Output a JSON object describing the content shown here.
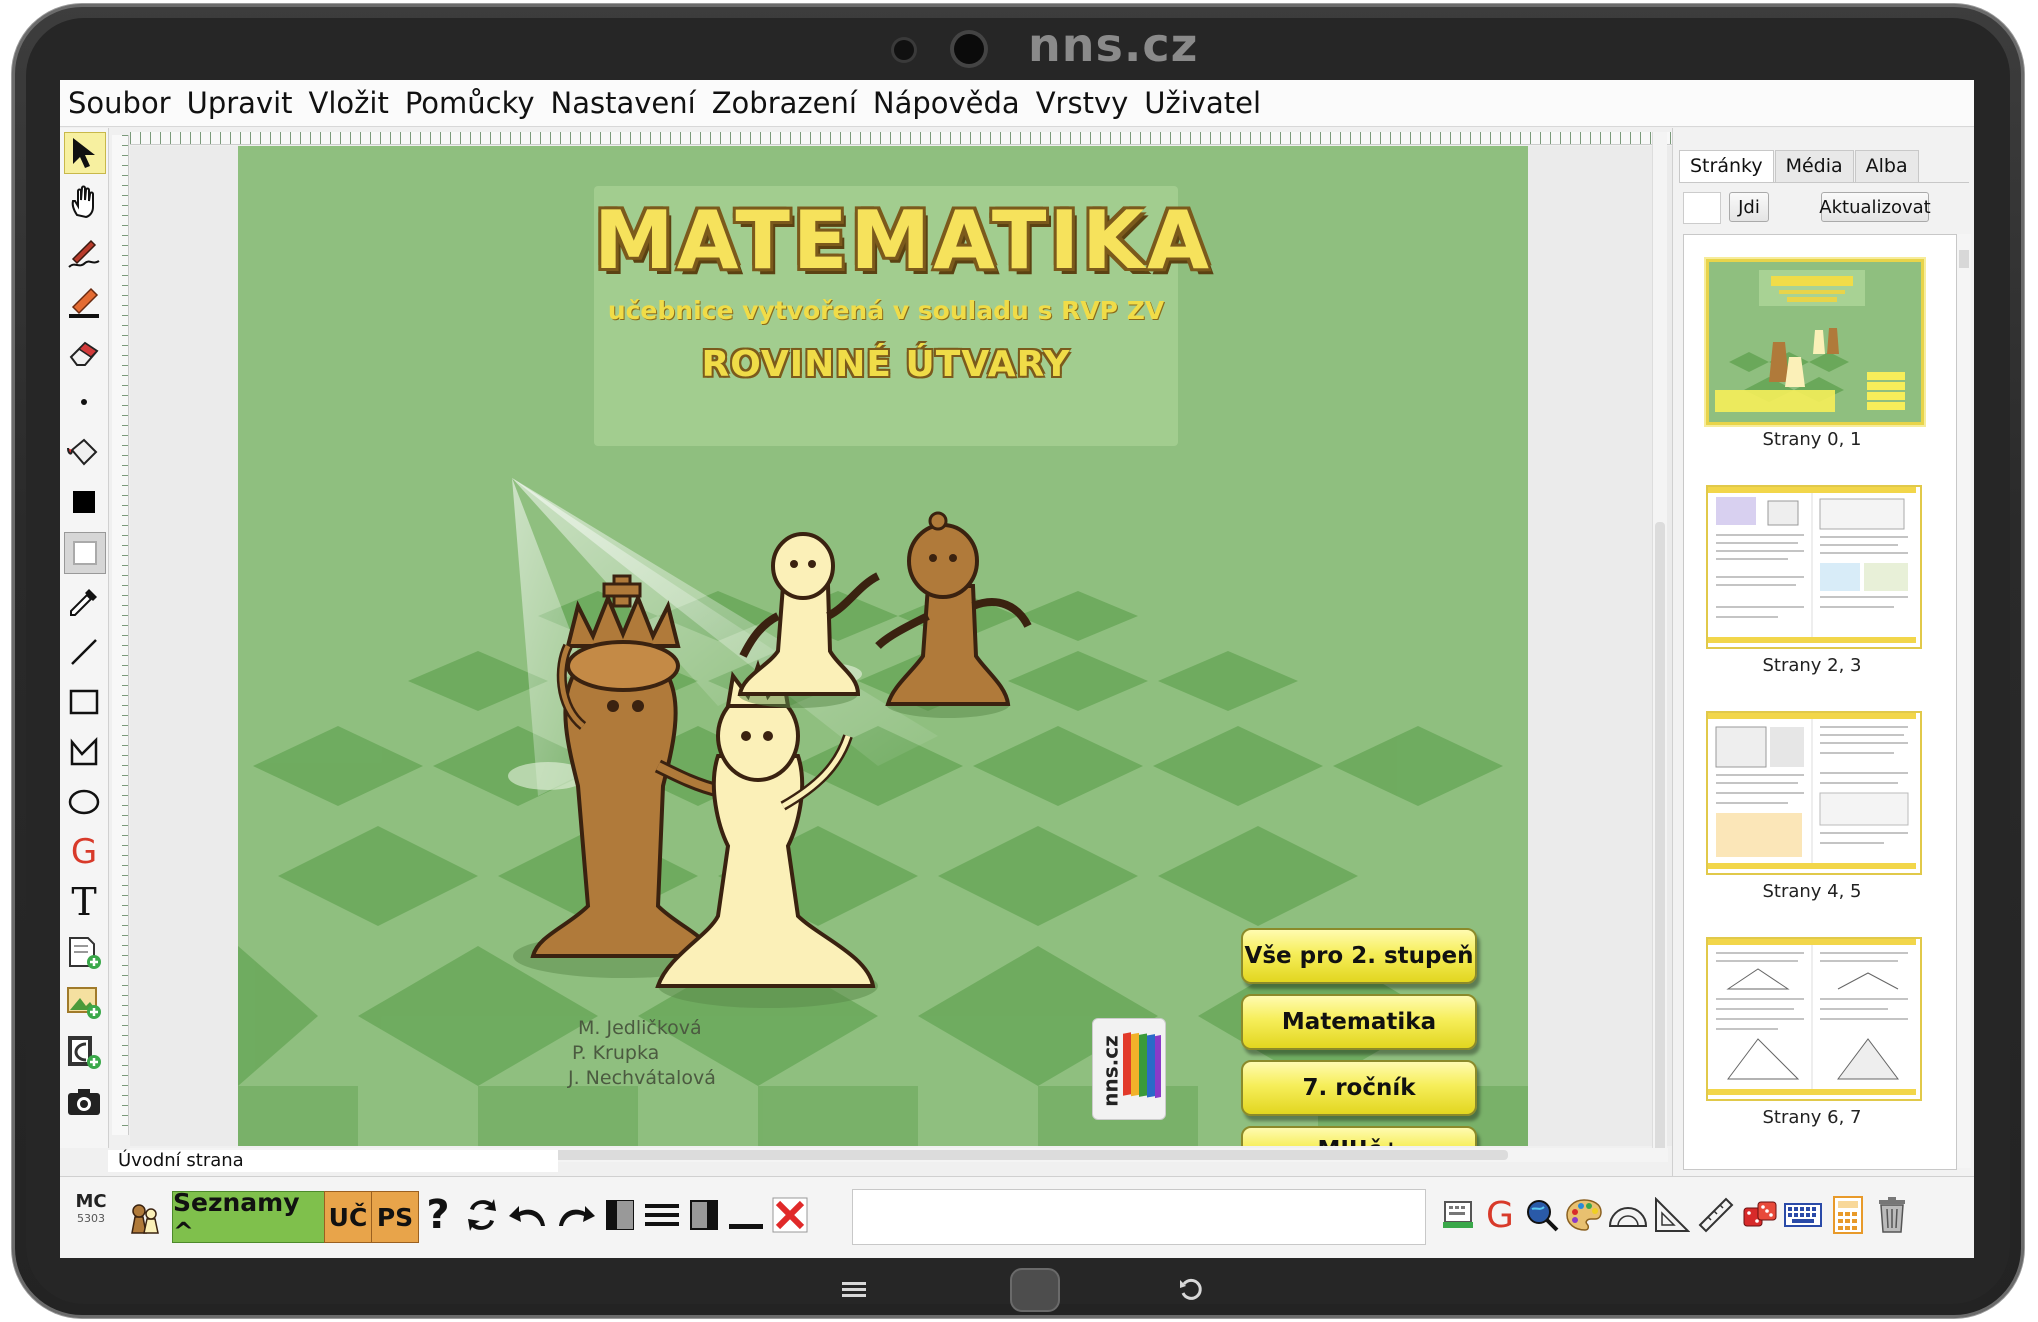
{
  "device": {
    "brand": "nns.cz"
  },
  "menubar": {
    "items": [
      "Soubor",
      "Upravit",
      "Vložit",
      "Pomůcky",
      "Nastavení",
      "Zobrazení",
      "Nápověda",
      "Vrstvy",
      "Uživatel"
    ]
  },
  "toolbar_left": {
    "tools": [
      {
        "name": "select-arrow-icon",
        "selected": true
      },
      {
        "name": "hand-icon"
      },
      {
        "name": "pen-icon"
      },
      {
        "name": "highlighter-icon"
      },
      {
        "name": "eraser-icon"
      },
      {
        "name": "dot-size-icon"
      },
      {
        "name": "fill-bucket-icon"
      },
      {
        "name": "fill-color-icon"
      },
      {
        "name": "stroke-color-icon"
      },
      {
        "name": "eyedropper-icon"
      },
      {
        "name": "line-icon"
      },
      {
        "name": "rectangle-icon"
      },
      {
        "name": "polygon-icon"
      },
      {
        "name": "ellipse-icon"
      },
      {
        "name": "geogebra-icon"
      },
      {
        "name": "text-icon"
      },
      {
        "name": "new-page-icon"
      },
      {
        "name": "insert-image-icon"
      },
      {
        "name": "insert-media-icon"
      },
      {
        "name": "camera-icon"
      }
    ]
  },
  "slide": {
    "title": "MATEMATIKA",
    "subtitle": "učebnice vytvořená v souladu s RVP ZV",
    "topic": "ROVINNÉ ÚTVARY",
    "authors": [
      "M. Jedličková",
      "P. Krupka",
      "J. Nechvátalová"
    ],
    "buttons": [
      "Vše pro 2. stupeň",
      "Matematika",
      "7. ročník",
      "MIUč+"
    ],
    "logo_text": "nns.cz"
  },
  "status": {
    "page_name": "Úvodní strana"
  },
  "right_panel": {
    "tabs": [
      "Stránky",
      "Média",
      "Alba"
    ],
    "active_tab": "Stránky",
    "go_button": "Jdi",
    "refresh_button": "Aktualizovat",
    "page_input_value": "",
    "thumbnails": [
      {
        "label": "Strany 0, 1",
        "selected": true
      },
      {
        "label": "Strany 2, 3"
      },
      {
        "label": "Strany 4, 5"
      },
      {
        "label": "Strany 6, 7"
      }
    ]
  },
  "bottom_bar": {
    "mc_label": "MC",
    "mc_number": "5303",
    "lists_button": "Seznamy ^",
    "uc_button": "UČ",
    "ps_button": "PS",
    "help_glyph": "?",
    "right_tools": [
      "keyboard-icon",
      "geogebra-icon",
      "search-globe-icon",
      "palette-icon",
      "protractor-icon",
      "set-square-icon",
      "ruler-icon",
      "dice-icon",
      "virtual-keyboard-icon",
      "calculator-icon",
      "trash-icon"
    ]
  },
  "colors": {
    "slide_green": "#8fbf7f",
    "title_yellow": "#f6e25c",
    "button_yellow": "#f6ee5a",
    "lists_green": "#7fc04c",
    "uc_orange": "#e8a44a"
  }
}
